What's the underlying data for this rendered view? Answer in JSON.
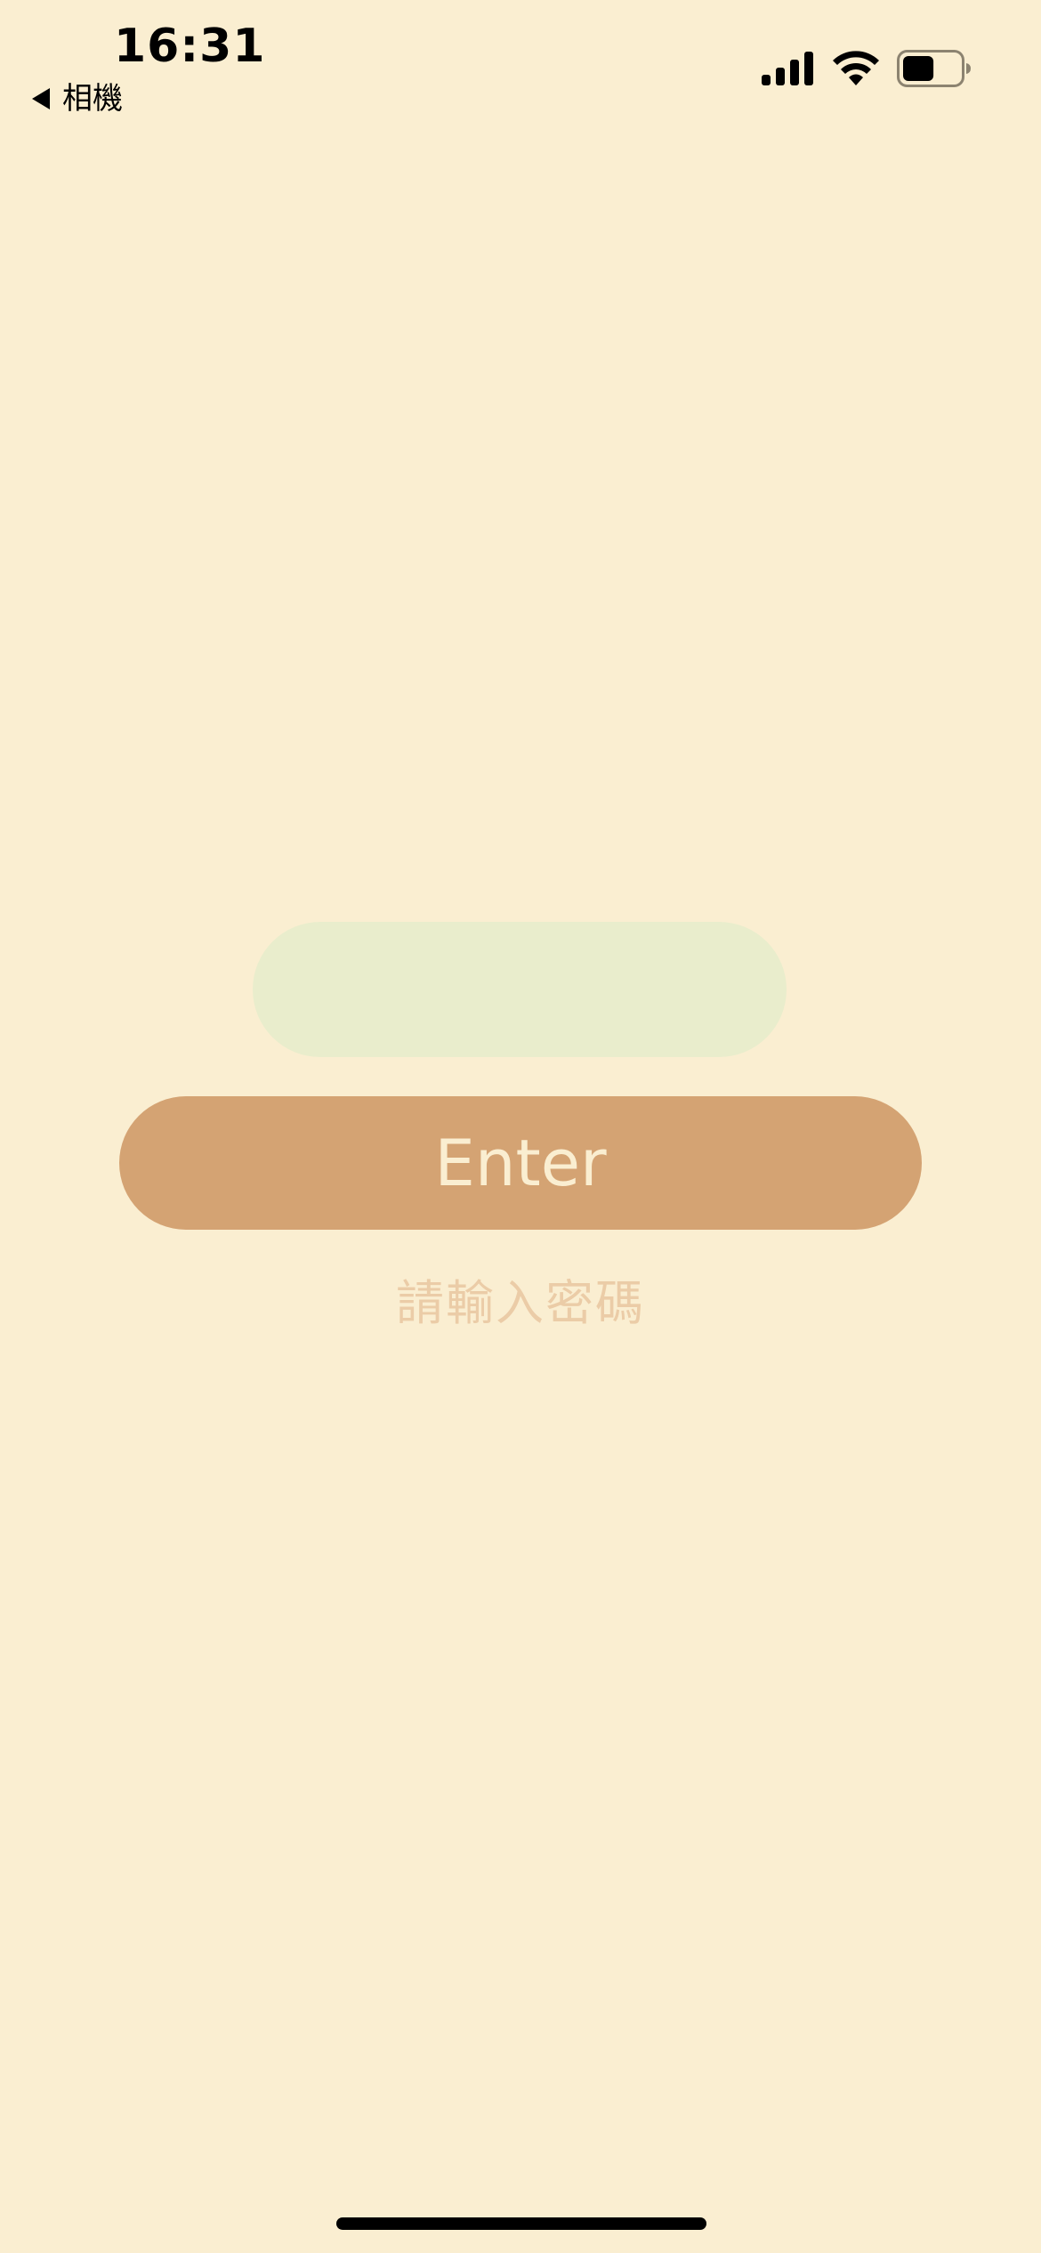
{
  "status_bar": {
    "time": "16:31",
    "back_label": "相機",
    "signal_icon": "cellular-signal-icon",
    "wifi_icon": "wifi-icon",
    "battery_icon": "battery-icon",
    "battery_level": 0.55
  },
  "form": {
    "password_value": "",
    "password_placeholder": "",
    "enter_label": "Enter",
    "hint": "請輸入密碼"
  },
  "colors": {
    "background": "#FAEED1",
    "input_background": "#E9EDCC",
    "button_background": "#D4A373",
    "button_text": "#FAEED1",
    "hint_text": "#EBCCA7"
  }
}
